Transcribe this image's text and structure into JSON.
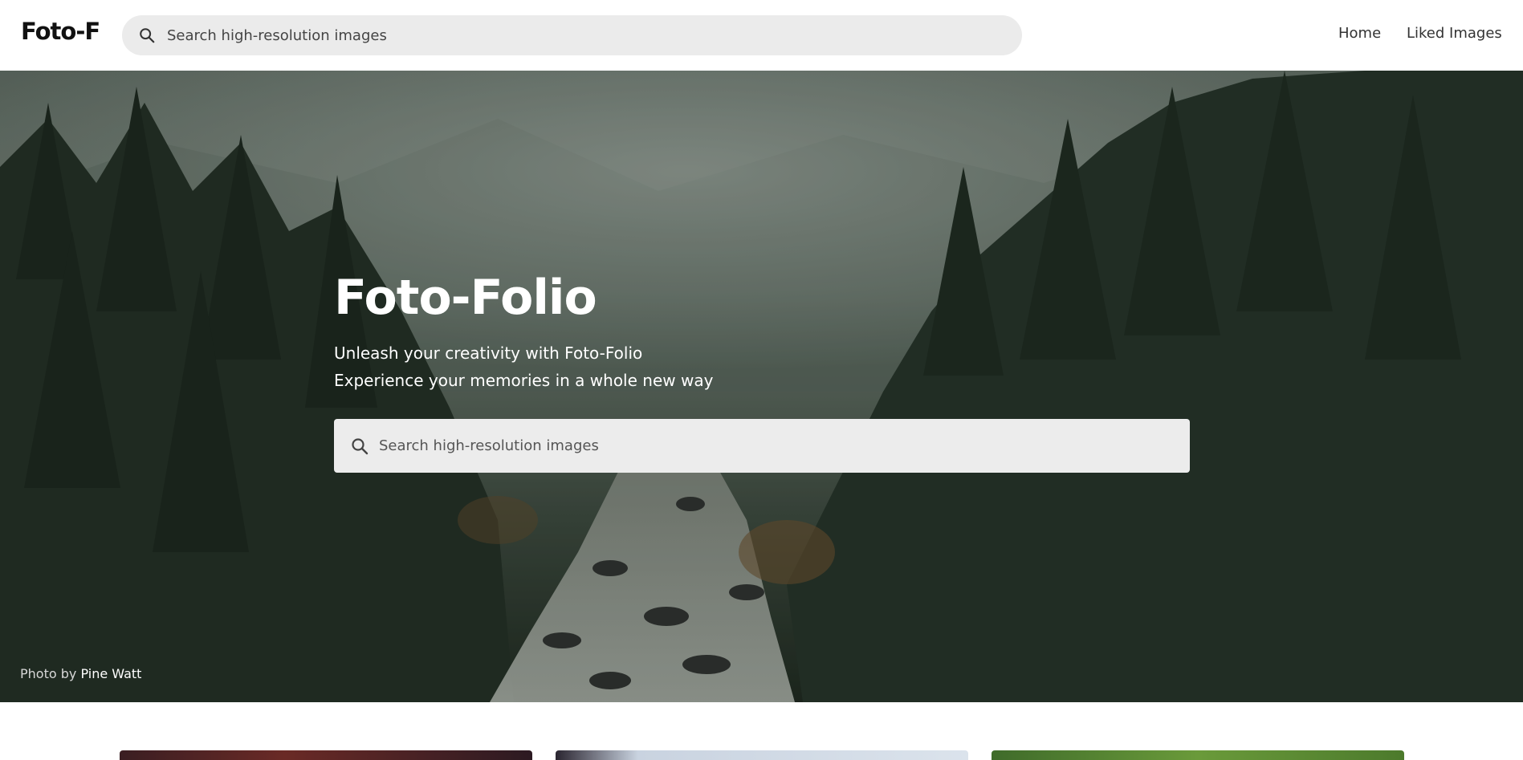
{
  "app": {
    "logo_text": "Foto-F"
  },
  "header": {
    "search": {
      "placeholder": "Search high-resolution images",
      "icon": "search-icon"
    },
    "nav": [
      {
        "label": "Home"
      },
      {
        "label": "Liked Images"
      }
    ]
  },
  "hero": {
    "title": "Foto-Folio",
    "subtitle_line1": "Unleash your creativity with Foto-Folio",
    "subtitle_line2": "Experience your memories in a whole new way",
    "search": {
      "placeholder": "Search high-resolution images",
      "icon": "search-icon"
    },
    "credit_prefix": "Photo by",
    "credit_author": "Pine Watt"
  },
  "colors": {
    "search_bg": "#ebebeb",
    "hero_overlay": "#2b3a2e",
    "text_dark": "#111111",
    "text_light": "#ffffff"
  }
}
